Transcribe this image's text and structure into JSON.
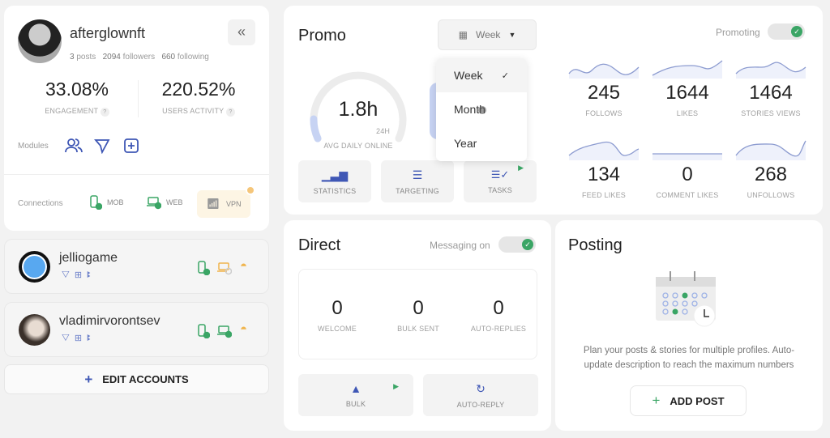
{
  "profile": {
    "username": "afterglownft",
    "posts": "3",
    "posts_label": "posts",
    "followers": "2094",
    "followers_label": "followers",
    "following": "660",
    "following_label": "following",
    "engagement": "33.08%",
    "engagement_label": "ENGAGEMENT",
    "activity": "220.52%",
    "activity_label": "USERS ACTIVITY",
    "help": "?",
    "modules_label": "Modules",
    "connections_label": "Connections",
    "mob": "MOB",
    "web": "WEB",
    "vpn": "VPN",
    "collapse": "«"
  },
  "accounts": [
    {
      "name": "jelliogame"
    },
    {
      "name": "vladimirvorontsev"
    }
  ],
  "edit_accounts": {
    "icon": "+",
    "label": "EDIT ACCOUNTS"
  },
  "promo": {
    "title": "Promo",
    "period": "Week",
    "promoting_label": "Promoting",
    "gauge_value": "1.8h",
    "gauge_max": "24H",
    "gauge_label": "AVG DAILY ONLINE",
    "gauge_fraction": 0.075,
    "dropdown": [
      {
        "label": "Week",
        "selected": true
      },
      {
        "label": "Month"
      },
      {
        "label": "Year"
      }
    ],
    "buttons": [
      {
        "label": "STATISTICS"
      },
      {
        "label": "TARGETING"
      },
      {
        "label": "TASKS"
      }
    ],
    "stats": [
      {
        "value": "245",
        "label": "FOLLOWS"
      },
      {
        "value": "1644",
        "label": "LIKES"
      },
      {
        "value": "1464",
        "label": "STORIES VIEWS"
      },
      {
        "value": "134",
        "label": "FEED LIKES"
      },
      {
        "value": "0",
        "label": "COMMENT LIKES"
      },
      {
        "value": "268",
        "label": "UNFOLLOWS"
      }
    ]
  },
  "direct": {
    "title": "Direct",
    "messaging_label": "Messaging on",
    "stats": [
      {
        "value": "0",
        "label": "WELCOME"
      },
      {
        "value": "0",
        "label": "BULK SENT"
      },
      {
        "value": "0",
        "label": "AUTO-REPLIES"
      }
    ],
    "buttons": [
      {
        "label": "BULK"
      },
      {
        "label": "AUTO-REPLY"
      }
    ]
  },
  "posting": {
    "title": "Posting",
    "description": "Plan your posts & stories for multiple profiles. Auto-update description to reach the maximum numbers",
    "add_icon": "+",
    "add_label": "ADD POST"
  },
  "colors": {
    "accent": "#3f57b5",
    "green": "#3aa565",
    "vpn": "#f0b44c",
    "background": "#f2f2f2"
  }
}
